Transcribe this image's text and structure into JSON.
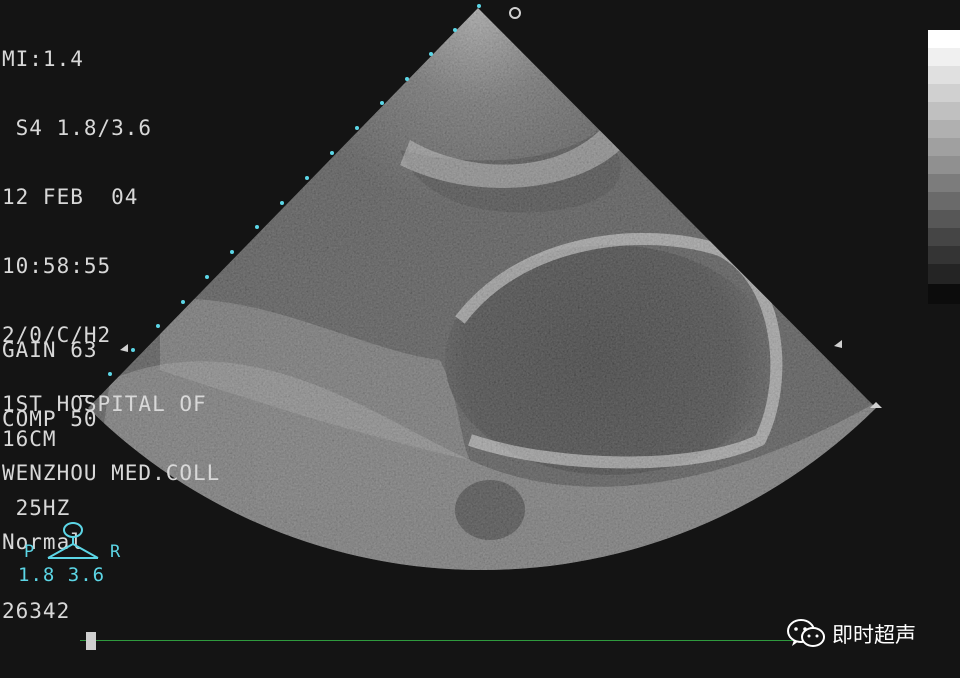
{
  "header": {
    "lines": [
      "MI:1.4",
      " S4 1.8/3.6",
      "12 FEB  04",
      "10:58:55",
      "2/0/C/H2",
      "1ST HOSPITAL OF",
      "WENZHOU MED.COLL",
      "Normal",
      "26342"
    ]
  },
  "settings": {
    "gain": "GAIN 63",
    "comp": "COMP 50"
  },
  "depth": {
    "depth": "16CM",
    "frame_rate": " 25HZ"
  },
  "probe": {
    "left_label": "P",
    "right_label": "R",
    "frequencies": "1.8 3.6"
  },
  "watermark": {
    "text": "即时超声",
    "icon": "wechat-icon"
  },
  "colors": {
    "overlay_text": "#d8d8d8",
    "probe_text": "#5cd6e6",
    "timeline": "#2f9a3e",
    "background": "#141414"
  }
}
